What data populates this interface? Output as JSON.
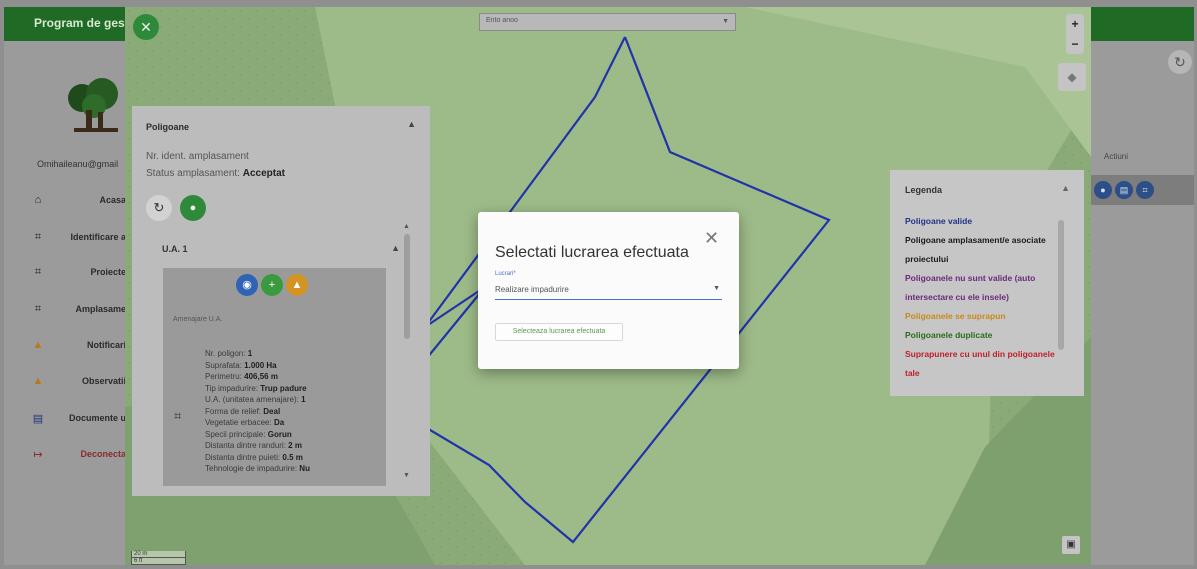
{
  "app": {
    "title": "Program de gesti",
    "user_email": "Omihaileanu@gmail",
    "sidebar": [
      {
        "icon": "home-icon",
        "glyph": "⌂",
        "label": "Acasa"
      },
      {
        "icon": "polygon-icon",
        "glyph": "⌗",
        "label": "Identificare a"
      },
      {
        "icon": "polygon-icon",
        "glyph": "⌗",
        "label": "Proiecte"
      },
      {
        "icon": "polygon-icon",
        "glyph": "⌗",
        "label": "Amplasame"
      },
      {
        "icon": "warning-icon",
        "glyph": "▲",
        "label": "Notificari"
      },
      {
        "icon": "warning-icon",
        "glyph": "▲",
        "label": "Observatii"
      },
      {
        "icon": "document-icon",
        "glyph": "▤",
        "label": "Documente u"
      },
      {
        "icon": "logout-icon",
        "glyph": "↦",
        "label": "Deconecta"
      }
    ],
    "right": {
      "actions_header": "Actiuni"
    }
  },
  "map": {
    "plot_select_placeholder": "Ento anoo",
    "close_glyph": "✕",
    "zoom_in": "+",
    "zoom_out": "−",
    "scale_line1": "20 m",
    "scale_line2": "6 ft"
  },
  "polygons_panel": {
    "title": "Poligoane",
    "ident_label": "Nr. ident. amplasament",
    "status_label": "Status amplasament:",
    "status_value": "Acceptat",
    "ua_label": "U.A. 1",
    "card_sub": "Amenajare U.A.",
    "details": [
      {
        "label": "Nr. poligon:",
        "value": "1"
      },
      {
        "label": "Suprafata:",
        "value": "1.000 Ha"
      },
      {
        "label": "Perimetru:",
        "value": "406,56 m"
      },
      {
        "label": "Tip impadurire:",
        "value": "Trup padure"
      },
      {
        "label": "U.A. (unitatea amenajare):",
        "value": "1"
      },
      {
        "label": "Forma de relief:",
        "value": "Deal"
      },
      {
        "label": "Vegetatie erbacee:",
        "value": "Da"
      },
      {
        "label": "Specii principale:",
        "value": "Gorun"
      },
      {
        "label": "Distanta dintre randuri:",
        "value": "2 m"
      },
      {
        "label": "Distanta dintre puieti:",
        "value": "0.5 m"
      },
      {
        "label": "Tehnologie de impadurire:",
        "value": "Nu"
      }
    ]
  },
  "legend": {
    "title": "Legenda",
    "items": [
      {
        "text": "Poligoane valide",
        "color": "#22328a"
      },
      {
        "text": "Poligoane amplasament/e asociate proiectului",
        "color": "#1a1a1a"
      },
      {
        "text": "Poligoanele nu sunt valide (auto intersectare cu ele insele)",
        "color": "#6b2a7d"
      },
      {
        "text": "Poligoanele se suprapun",
        "color": "#c98a18"
      },
      {
        "text": "Poligoanele duplicate",
        "color": "#2a6b1e"
      },
      {
        "text": "Suprapunere cu unul din poligoanele tale",
        "color": "#c0202a"
      }
    ]
  },
  "dialog": {
    "title": "Selectati lucrarea efectuata",
    "field_label": "Lucrari*",
    "field_value": "Realizare impadurire",
    "confirm_label": "Selecteaza lucrarea efectuata",
    "close_glyph": "✕"
  },
  "colors": {
    "topbar": "#1f6b26",
    "accent_green": "#2e8a3a",
    "polygon_stroke": "#2233aa",
    "field_blue": "#4a6fd3"
  }
}
